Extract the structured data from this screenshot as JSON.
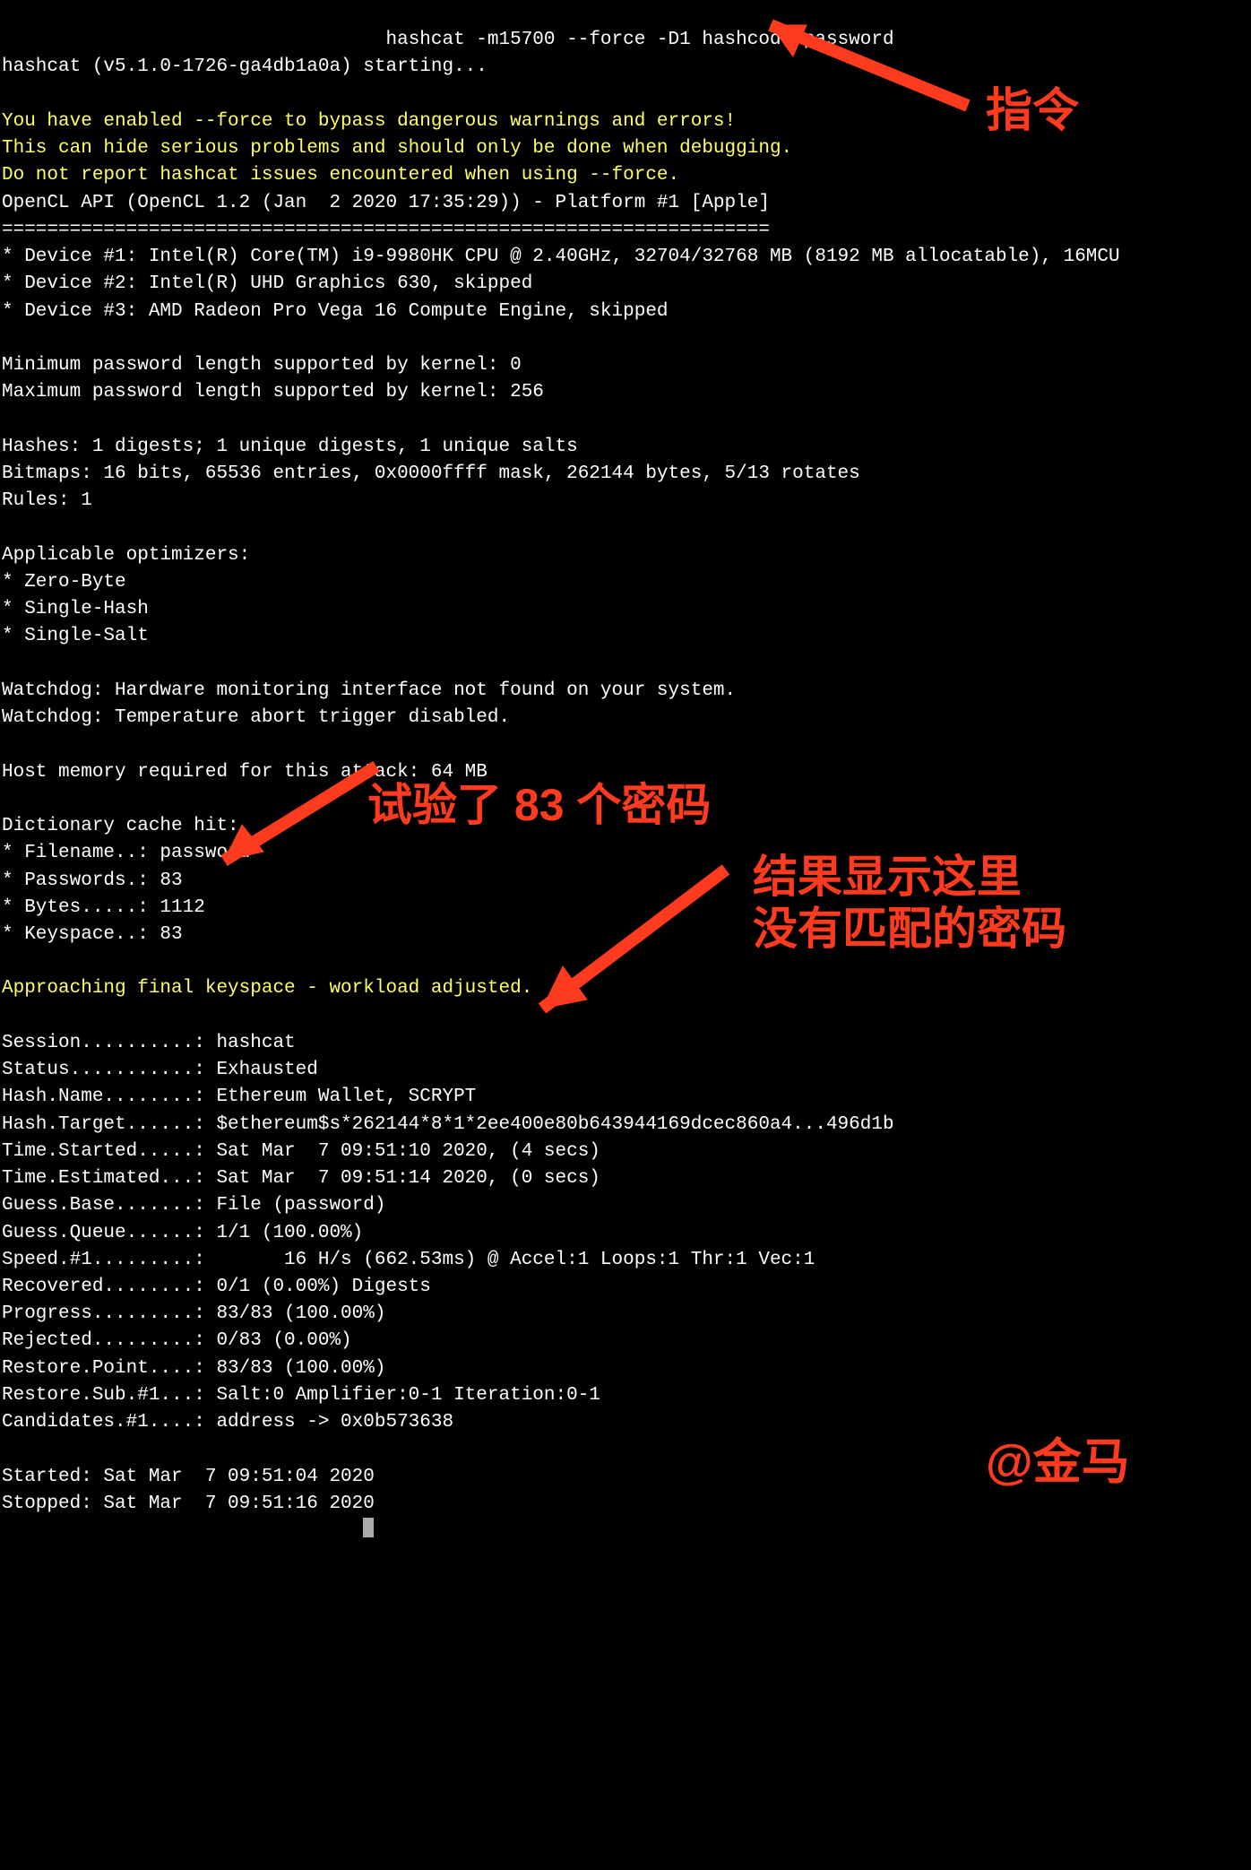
{
  "cmd_prefix": "                                  ",
  "cmd": "hashcat -m15700 --force -D1 hashcode password",
  "start": "hashcat (v5.1.0-1726-ga4db1a0a) starting...",
  "warn1": "You have enabled --force to bypass dangerous warnings and errors!",
  "warn2": "This can hide serious problems and should only be done when debugging.",
  "warn3": "Do not report hashcat issues encountered when using --force.",
  "ocl": "OpenCL API (OpenCL 1.2 (Jan  2 2020 17:35:29)) - Platform #1 [Apple]",
  "sep": "====================================================================",
  "dev1": "* Device #1: Intel(R) Core(TM) i9-9980HK CPU @ 2.40GHz, 32704/32768 MB (8192 MB allocatable), 16MCU",
  "dev2": "* Device #2: Intel(R) UHD Graphics 630, skipped",
  "dev3": "* Device #3: AMD Radeon Pro Vega 16 Compute Engine, skipped",
  "min": "Minimum password length supported by kernel: 0",
  "max": "Maximum password length supported by kernel: 256",
  "hashes": "Hashes: 1 digests; 1 unique digests, 1 unique salts",
  "bitmaps": "Bitmaps: 16 bits, 65536 entries, 0x0000ffff mask, 262144 bytes, 5/13 rotates",
  "rules": "Rules: 1",
  "opt0": "Applicable optimizers:",
  "opt1": "* Zero-Byte",
  "opt2": "* Single-Hash",
  "opt3": "* Single-Salt",
  "wd1": "Watchdog: Hardware monitoring interface not found on your system.",
  "wd2": "Watchdog: Temperature abort trigger disabled.",
  "hostmem": "Host memory required for this attack: 64 MB",
  "dict0": "Dictionary cache hit:",
  "dict1": "* Filename..: password",
  "dict2": "* Passwords.: 83",
  "dict3": "* Bytes.....: 1112",
  "dict4": "* Keyspace..: 83",
  "approach": "Approaching final keyspace - workload adjusted.",
  "s_session": "Session..........: hashcat",
  "s_status": "Status...........: Exhausted",
  "s_hashname": "Hash.Name........: Ethereum Wallet, SCRYPT",
  "s_target": "Hash.Target......: $ethereum$s*262144*8*1*2ee400e80b643944169dcec860a4...496d1b",
  "s_started": "Time.Started.....: Sat Mar  7 09:51:10 2020, (4 secs)",
  "s_estimated": "Time.Estimated...: Sat Mar  7 09:51:14 2020, (0 secs)",
  "s_gbase": "Guess.Base.......: File (password)",
  "s_gqueue": "Guess.Queue......: 1/1 (100.00%)",
  "s_speed": "Speed.#1.........:       16 H/s (662.53ms) @ Accel:1 Loops:1 Thr:1 Vec:1",
  "s_recovered": "Recovered........: 0/1 (0.00%) Digests",
  "s_progress": "Progress.........: 83/83 (100.00%)",
  "s_rejected": "Rejected.........: 0/83 (0.00%)",
  "s_rpoint": "Restore.Point....: 83/83 (100.00%)",
  "s_rsub": "Restore.Sub.#1...: Salt:0 Amplifier:0-1 Iteration:0-1",
  "s_cand": "Candidates.#1....: address -> 0x0b573638",
  "started": "Started: Sat Mar  7 09:51:04 2020",
  "stopped": "Stopped: Sat Mar  7 09:51:16 2020",
  "annotations": {
    "cmd_label": "指令",
    "pw_label": "试验了 83 个密码",
    "result_label": "结果显示这里\n没有匹配的密码",
    "sig": "@金马"
  }
}
